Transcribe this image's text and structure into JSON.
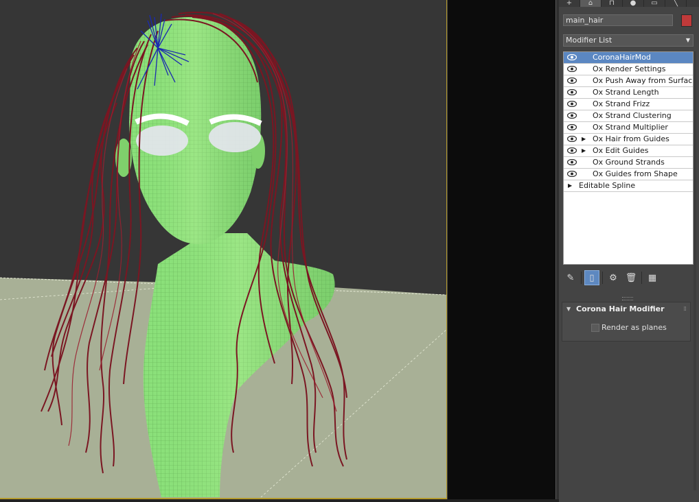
{
  "viewport": {
    "colors": {
      "background": "#363636",
      "ground": "#a8b096",
      "mesh": "#8be07a",
      "hair": "#7a1622",
      "guide": "#1a2ab0",
      "eyes": "#e6e6f0",
      "frame": "#b49a2c"
    }
  },
  "panel": {
    "tabs": [
      "plus-icon",
      "modify-icon",
      "hierarchy-icon",
      "motion-icon",
      "display-icon",
      "utilities-icon"
    ],
    "object_name": "main_hair",
    "object_color": "#c03a3a",
    "modifier_list": "Modifier List",
    "stack": [
      {
        "label": "CoronaHairMod",
        "selected": true,
        "eye": true,
        "expand": false
      },
      {
        "label": "Ox Render Settings",
        "selected": false,
        "eye": true,
        "expand": false
      },
      {
        "label": "Ox Push Away from Surface",
        "selected": false,
        "eye": true,
        "expand": false
      },
      {
        "label": "Ox Strand Length",
        "selected": false,
        "eye": true,
        "expand": false
      },
      {
        "label": "Ox Strand Frizz",
        "selected": false,
        "eye": true,
        "expand": false
      },
      {
        "label": "Ox Strand Clustering",
        "selected": false,
        "eye": true,
        "expand": false
      },
      {
        "label": "Ox Strand Multiplier",
        "selected": false,
        "eye": true,
        "expand": false
      },
      {
        "label": "Ox Hair from Guides",
        "selected": false,
        "eye": true,
        "expand": true
      },
      {
        "label": "Ox Edit Guides",
        "selected": false,
        "eye": true,
        "expand": true
      },
      {
        "label": "Ox Ground Strands",
        "selected": false,
        "eye": true,
        "expand": false
      },
      {
        "label": "Ox Guides from Shape",
        "selected": false,
        "eye": true,
        "expand": false
      },
      {
        "label": "Editable Spline",
        "selected": false,
        "eye": false,
        "expand": true
      }
    ],
    "tools": [
      "pin-stack-icon",
      "show-end-result-icon",
      "make-unique-icon",
      "remove-modifier-icon",
      "configure-sets-icon"
    ],
    "rollout": {
      "title": "Corona Hair Modifier",
      "checkbox_label": "Render as planes",
      "checked": false
    }
  }
}
